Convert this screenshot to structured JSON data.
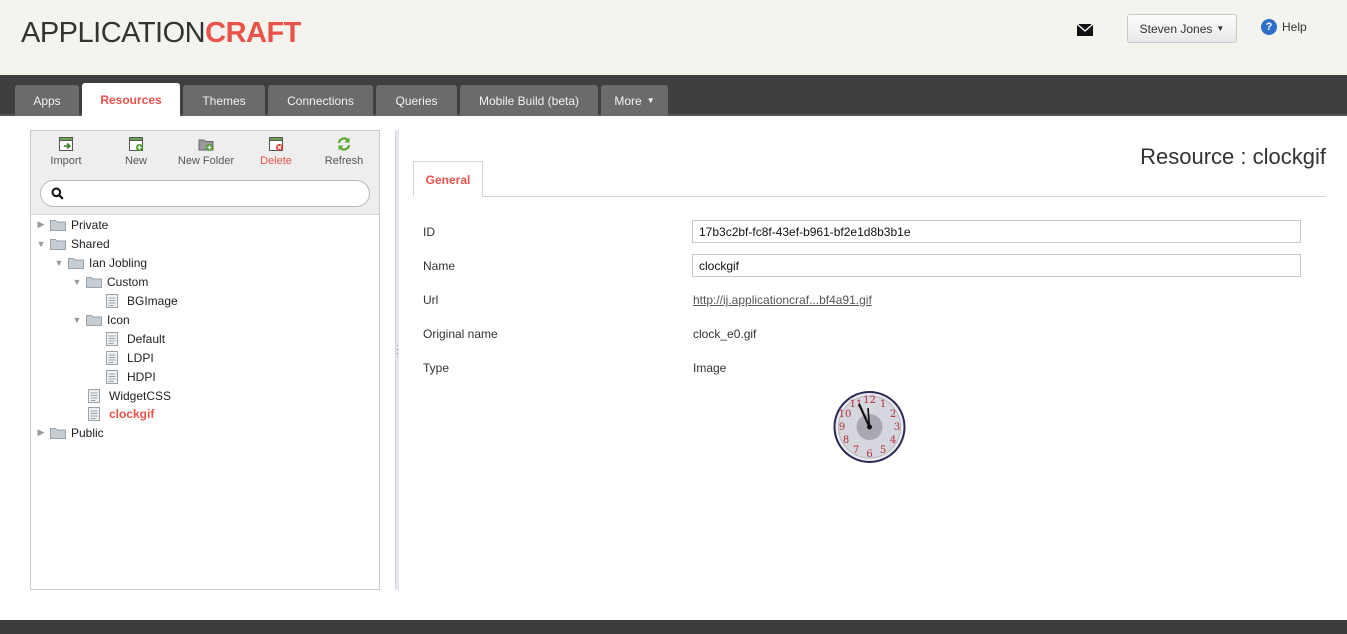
{
  "header": {
    "logo_app": "APPLICATION",
    "logo_craft": "CRAFT",
    "user_name": "Steven Jones",
    "help_label": "Help",
    "icons": [
      "mail-icon",
      "help-icon"
    ]
  },
  "nav": {
    "tabs": [
      {
        "label": "Apps"
      },
      {
        "label": "Resources",
        "active": true
      },
      {
        "label": "Themes"
      },
      {
        "label": "Connections"
      },
      {
        "label": "Queries"
      },
      {
        "label": "Mobile Build (beta)"
      },
      {
        "label": "More"
      }
    ]
  },
  "toolbar": {
    "import_label": "Import",
    "new_label": "New",
    "new_folder_label": "New Folder",
    "delete_label": "Delete",
    "refresh_label": "Refresh"
  },
  "search": {
    "value": "",
    "placeholder": ""
  },
  "tree": {
    "private": "Private",
    "shared": "Shared",
    "ian_jobling": "Ian Jobling",
    "custom": "Custom",
    "bgimage": "BGImage",
    "icon": "Icon",
    "default": "Default",
    "ldpi": "LDPI",
    "hdpi": "HDPI",
    "widgetcss": "WidgetCSS",
    "clockgif": "clockgif",
    "public": "Public"
  },
  "resource": {
    "title": "Resource : clockgif",
    "tab_general": "General",
    "fields": {
      "id_label": "ID",
      "id_value": "17b3c2bf-fc8f-43ef-b961-bf2e1d8b3b1e",
      "name_label": "Name",
      "name_value": "clockgif",
      "url_label": "Url",
      "url_value": "http://ij.applicationcraf...bf4a91.gif",
      "original_name_label": "Original name",
      "original_name_value": "clock_e0.gif",
      "type_label": "Type",
      "type_value": "Image"
    }
  },
  "colors": {
    "accent": "#e8534a",
    "tab_bar": "#3f3f3f",
    "header_bg": "#f5f3ee"
  }
}
